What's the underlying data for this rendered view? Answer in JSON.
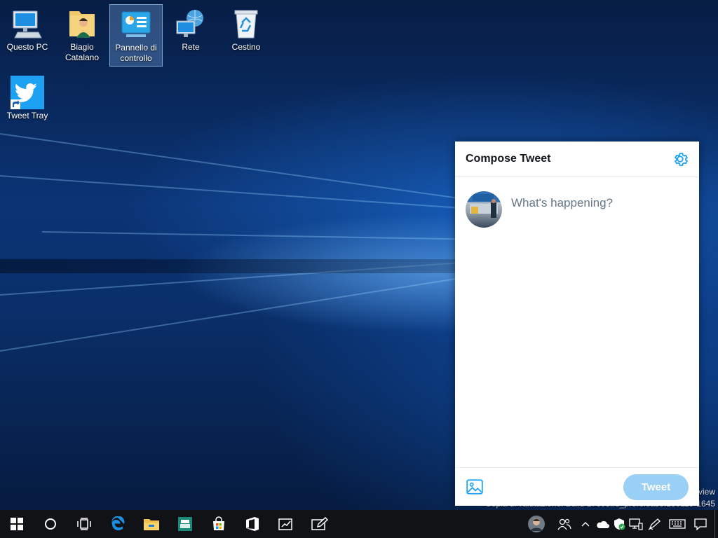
{
  "desktop": {
    "icons": [
      {
        "id": "questo-pc",
        "label": "Questo PC",
        "icon": "computer-icon"
      },
      {
        "id": "biagio-catalano",
        "label": "Biagio Catalano",
        "icon": "user-folder-icon"
      },
      {
        "id": "pannello-di-controllo",
        "label": "Pannello di controllo",
        "icon": "control-panel-icon",
        "selected": true
      },
      {
        "id": "rete",
        "label": "Rete",
        "icon": "network-icon"
      },
      {
        "id": "cestino",
        "label": "Cestino",
        "icon": "recycle-bin-icon"
      },
      {
        "id": "tweet-tray",
        "label": "Tweet Tray",
        "icon": "twitter-shortcut-icon"
      }
    ]
  },
  "compose_panel": {
    "title": "Compose Tweet",
    "input_placeholder": "What's happening?",
    "input_value": "",
    "tweet_button_label": "Tweet",
    "tweet_button_color": "#9ad0f5",
    "accent_color": "#1da1f2"
  },
  "watermark": {
    "line1": "view",
    "line2": "Copia di valutazione. Build 17603.rs_prerelease.180119-1645"
  },
  "taskbar": {
    "buttons": [
      "start-icon",
      "cortana-icon",
      "task-view-icon",
      "edge-icon",
      "file-explorer-icon",
      "app-icon",
      "store-icon",
      "office-icon",
      "whiteboard-icon",
      "sketch-icon"
    ],
    "tray": [
      "people-icon",
      "chevron-up-icon",
      "onedrive-icon",
      "defender-icon",
      "network-icon",
      "pen-icon",
      "keyboard-icon",
      "notification-icon"
    ]
  }
}
